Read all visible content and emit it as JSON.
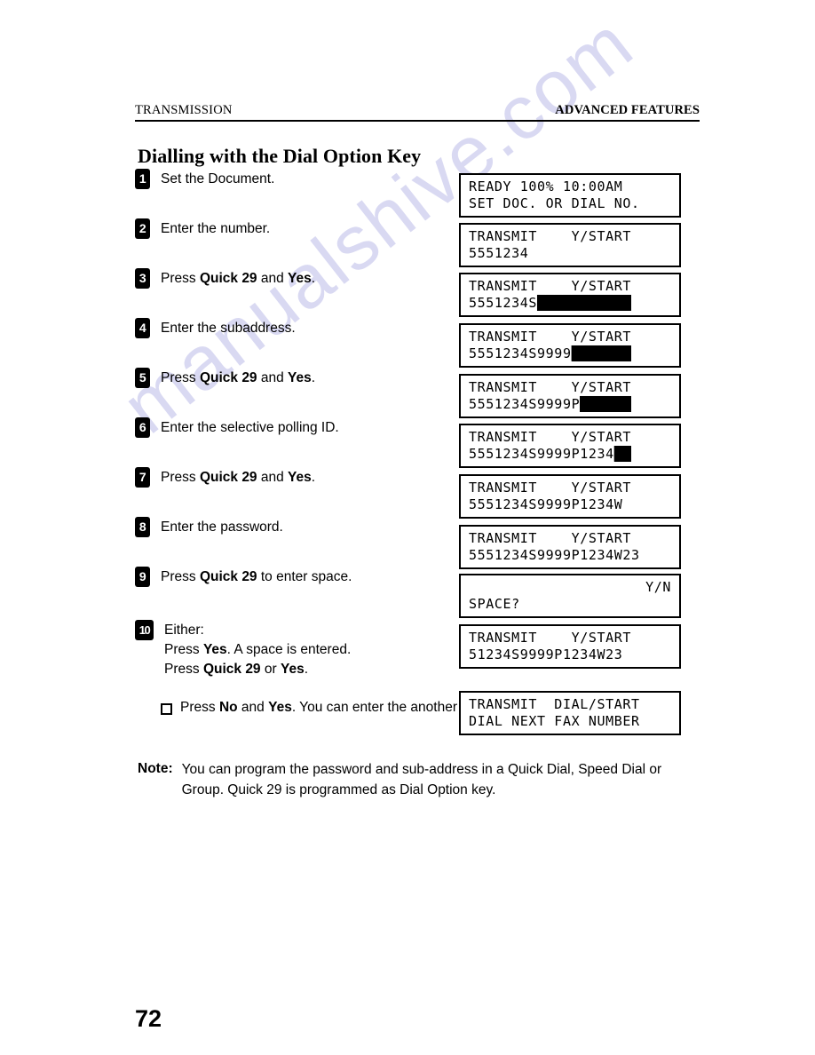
{
  "header": {
    "left": "TRANSMISSION",
    "right": "ADVANCED FEATURES"
  },
  "title": "Dialling with the Dial Option Key",
  "steps": [
    {
      "num": "1",
      "text": "Set the Document."
    },
    {
      "num": "2",
      "text": "Enter the number."
    },
    {
      "num": "3",
      "text": "Press Quick 29 and Yes."
    },
    {
      "num": "4",
      "text": "Enter the subaddress."
    },
    {
      "num": "5",
      "text": "Press Quick 29 and Yes."
    },
    {
      "num": "6",
      "text": "Enter the selective polling ID."
    },
    {
      "num": "7",
      "text": "Press Quick 29 and Yes."
    },
    {
      "num": "8",
      "text": "Enter the password."
    },
    {
      "num": "9",
      "text": "Press Quick 29 to enter space."
    },
    {
      "num": "10",
      "text": "Either:\nPress Yes. A space is entered.\nPress Quick 29 or Yes."
    }
  ],
  "step10_bold": [
    "Quick 29",
    "Yes",
    "No"
  ],
  "substep": {
    "bullet": "square-bullet",
    "text": "Press No and Yes. You can enter the another fax number."
  },
  "displays": [
    {
      "line1": "READY 100% 10:00AM",
      "line2": "SET DOC. OR DIAL NO.",
      "align1": "left",
      "blocks": 0
    },
    {
      "line1": "TRANSMIT    Y/START",
      "line2": "5551234",
      "align1": "left",
      "blocks": 0
    },
    {
      "line1": "TRANSMIT    Y/START",
      "line2": "5551234S",
      "align1": "left",
      "blocks": 11
    },
    {
      "line1": "TRANSMIT    Y/START",
      "line2": "5551234S9999",
      "align1": "left",
      "blocks": 7
    },
    {
      "line1": "TRANSMIT    Y/START",
      "line2": "5551234S9999P",
      "align1": "left",
      "blocks": 6
    },
    {
      "line1": "TRANSMIT    Y/START",
      "line2": "5551234S9999P1234",
      "align1": "left",
      "blocks": 2
    },
    {
      "line1": "TRANSMIT    Y/START",
      "line2": "5551234S9999P1234W",
      "align1": "left",
      "blocks": 0
    },
    {
      "line1": "TRANSMIT    Y/START",
      "line2": "5551234S9999P1234W23",
      "align1": "left",
      "blocks": 0
    },
    {
      "line1": "Y/N",
      "line2": "SPACE?",
      "align1": "right",
      "blocks": 0
    },
    {
      "line1": "TRANSMIT    Y/START",
      "line2": "51234S9999P1234W23",
      "align1": "left",
      "blocks": 0
    },
    {
      "line1": "TRANSMIT  DIAL/START",
      "line2": "DIAL NEXT FAX NUMBER",
      "align1": "left",
      "blocks": 0
    }
  ],
  "note": {
    "label": "Note:",
    "text": "You can program the password and sub-address in a Quick Dial, Speed Dial or Group. Quick 29 is programmed as Dial Option key."
  },
  "folio": "72",
  "watermark": "manualshive.com"
}
